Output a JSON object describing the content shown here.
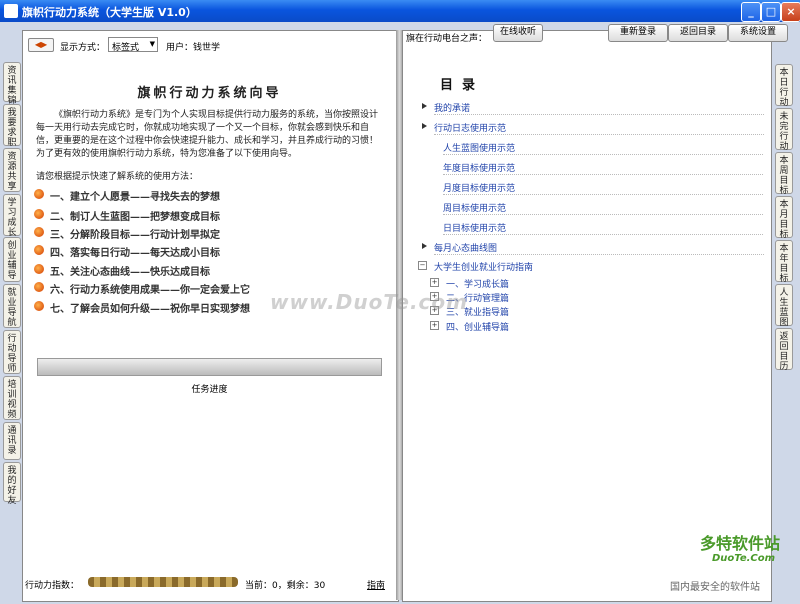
{
  "window": {
    "title": "旗帜行动力系统（大学生版 V1.0）"
  },
  "left_tabs": [
    "资讯集锦",
    "我要求职",
    "资源共享",
    "学习成长",
    "创业辅导",
    "就业导航",
    "行动导师",
    "培训视频",
    "通讯录",
    "我的好友"
  ],
  "right_tabs": [
    "本日行动",
    "未完行动",
    "本周目标",
    "本月目标",
    "本年目标",
    "人生蓝图",
    "返回目历"
  ],
  "toolbar": {
    "display_label": "显示方式：",
    "display_value": "标签式",
    "user_label": "用户：钱世学"
  },
  "radio": {
    "label": "旗在行动电台之声：",
    "button": "在线收听"
  },
  "top_buttons": {
    "relogin": "重新登录",
    "back_toc": "返回目录",
    "settings": "系统设置"
  },
  "guide": {
    "title": "旗帜行动力系统向导",
    "intro": "《旗帜行动力系统》是专门为个人实现目标提供行动力服务的系统，当你按照设计每一天用行动去完成它时，你就成功地实现了一个又一个目标，你就会感到快乐和自信，更重要的是在这个过程中你会快速提升能力、成长和学习，并且养成行动的习惯！为了更有效的使用旗帜行动力系统，特为您准备了以下使用向导。",
    "prompt": "请您根据提示快速了解系统的使用方法：",
    "steps": [
      "一、建立个人愿景——寻找失去的梦想",
      "二、制订人生蓝图——把梦想变成目标",
      "三、分解阶段目标——行动计划早拟定",
      "四、落实每日行动——每天达成小目标",
      "五、关注心态曲线——快乐达成目标",
      "六、行动力系统使用成果——你一定会爱上它",
      "七、了解会员如何升级——祝你早日实现梦想"
    ],
    "progress_label": "任务进度",
    "progress": 0
  },
  "footer": {
    "index_label": "行动力指数：",
    "status": "当前：0，剩余：30",
    "guide_link": "指南"
  },
  "toc": {
    "title": "目  录",
    "items": {
      "promise": "我的承诺",
      "journal": "行动日志使用示范",
      "life": "人生蓝图使用示范",
      "year": "年度目标使用示范",
      "month": "月度目标使用示范",
      "week": "周目标使用示范",
      "day": "日目标使用示范",
      "mood": "每月心态曲线图",
      "guide": "大学生创业就业行动指南",
      "g1": "一、学习成长篇",
      "g2": "二、行动管理篇",
      "g3": "三、就业指导篇",
      "g4": "四、创业辅导篇"
    }
  },
  "watermark": {
    "site": "www.DuoTe.com",
    "brand": "多特软件站",
    "domain": "DuoTe.Com",
    "slogan": "国内最安全的软件站"
  },
  "colors": {
    "titlebar": "#0a55de",
    "guide_title": "#222222",
    "toc_link": "#2244aa"
  }
}
